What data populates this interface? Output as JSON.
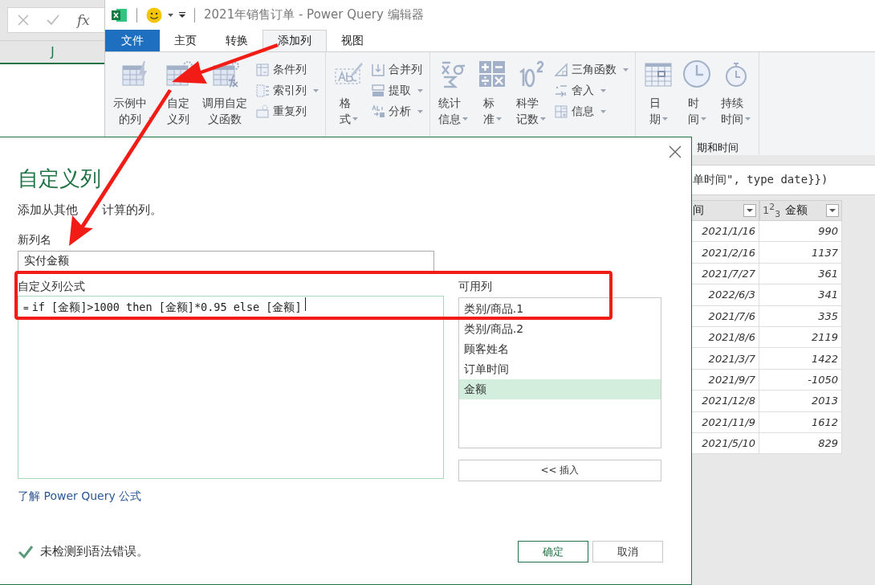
{
  "excel": {
    "fx": "fx",
    "column": "J"
  },
  "window": {
    "title": "2021年销售订单 - Power Query 编辑器"
  },
  "tabs": [
    {
      "label": "文件",
      "kind": "file",
      "selected": false
    },
    {
      "label": "主页",
      "kind": "tab",
      "selected": false
    },
    {
      "label": "转换",
      "kind": "tab",
      "selected": false
    },
    {
      "label": "添加列",
      "kind": "tab",
      "selected": true
    },
    {
      "label": "视图",
      "kind": "tab",
      "selected": false
    }
  ],
  "ribbon": {
    "groups": [
      {
        "items": [
          {
            "kind": "big",
            "label": "示例中的列",
            "dropdown": true
          },
          {
            "kind": "big",
            "label": "自定义列",
            "dropdown": false
          },
          {
            "kind": "big",
            "label": "调用自定义函数",
            "dropdown": false
          },
          {
            "kind": "stack",
            "buttons": [
              {
                "label": "条件列",
                "dropdown": false
              },
              {
                "label": "索引列",
                "dropdown": true
              },
              {
                "label": "重复列",
                "dropdown": false
              }
            ]
          }
        ]
      },
      {
        "items": [
          {
            "kind": "big",
            "label": "格式",
            "dropdown": true
          },
          {
            "kind": "stack",
            "buttons": [
              {
                "label": "合并列",
                "dropdown": false
              },
              {
                "label": "提取",
                "dropdown": true
              },
              {
                "label": "分析",
                "dropdown": true
              }
            ]
          }
        ]
      },
      {
        "items": [
          {
            "kind": "big",
            "label": "统计信息",
            "dropdown": true
          },
          {
            "kind": "big",
            "label": "标准",
            "dropdown": true
          },
          {
            "kind": "big",
            "label": "科学记数",
            "dropdown": true
          },
          {
            "kind": "stack",
            "buttons": [
              {
                "label": "三角函数",
                "dropdown": true
              },
              {
                "label": "舍入",
                "dropdown": true
              },
              {
                "label": "信息",
                "dropdown": true
              }
            ]
          }
        ]
      },
      {
        "label": "期和时间",
        "items": [
          {
            "kind": "big",
            "label": "日期",
            "dropdown": true
          },
          {
            "kind": "big",
            "label": "时间",
            "dropdown": true
          },
          {
            "kind": "big",
            "label": "持续时间",
            "dropdown": true
          }
        ]
      }
    ]
  },
  "formula_bar": {
    "text": "单时间\", type date}})"
  },
  "table": {
    "columns": [
      {
        "label": "间"
      },
      {
        "label": "金额",
        "type_icon": "1$^{2}$$_{3}$"
      }
    ],
    "rows": [
      [
        "2021/1/16",
        "990"
      ],
      [
        "2021/2/16",
        "1137"
      ],
      [
        "2021/7/27",
        "361"
      ],
      [
        "2022/6/3",
        "341"
      ],
      [
        "2021/7/6",
        "335"
      ],
      [
        "2021/8/6",
        "2119"
      ],
      [
        "2021/3/7",
        "1422"
      ],
      [
        "2021/9/7",
        "-1050"
      ],
      [
        "2021/12/8",
        "2013"
      ],
      [
        "2021/11/9",
        "1612"
      ],
      [
        "2021/5/10",
        "829"
      ]
    ]
  },
  "dialog": {
    "title": "自定义列",
    "description_parts": [
      "添加从其他",
      "计算的列。"
    ],
    "name_label": "新列名",
    "name_value": "实付金额",
    "formula_label": "自定义列公式",
    "formula_prefix": "=",
    "formula": "if [金额]>1000 then [金额]*0.95 else [金额]",
    "columns_label": "可用列",
    "available_columns": [
      {
        "label": "类别/商品.1",
        "selected": false
      },
      {
        "label": "类别/商品.2",
        "selected": false
      },
      {
        "label": "顾客姓名",
        "selected": false
      },
      {
        "label": "订单时间",
        "selected": false
      },
      {
        "label": "金额",
        "selected": true
      }
    ],
    "insert_button": "<< 插入",
    "help_link": "了解 Power Query 公式",
    "status": {
      "ok": true,
      "text": "未检测到语法错误。"
    },
    "ok_button": "确定",
    "cancel_button": "取消"
  }
}
